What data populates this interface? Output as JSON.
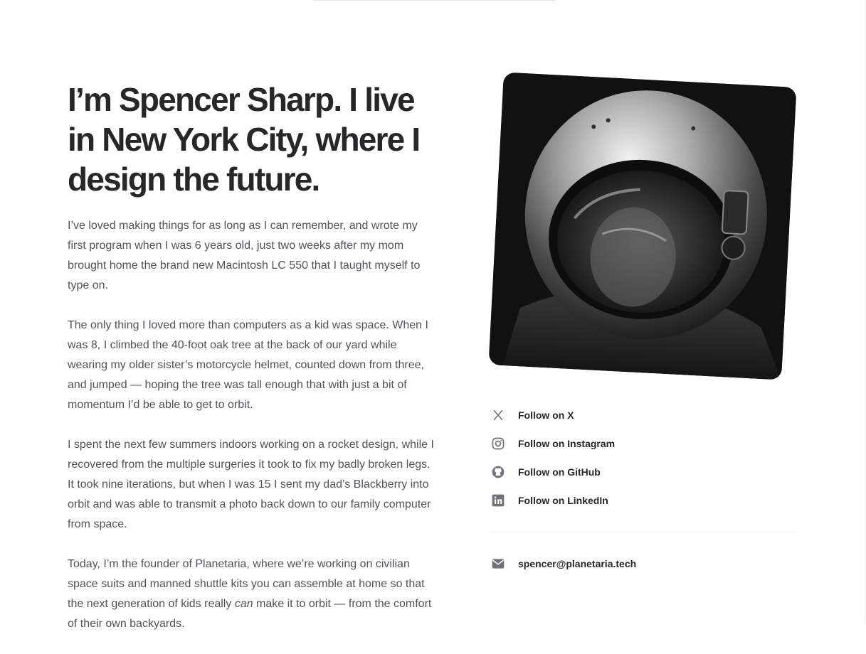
{
  "hero": {
    "headline": "I’m Spencer Sharp. I live in New York City, where I design the future."
  },
  "bio": {
    "p1": "I’ve loved making things for as long as I can remember, and wrote my first program when I was 6 years old, just two weeks after my mom brought home the brand new Macintosh LC 550 that I taught myself to type on.",
    "p2": "The only thing I loved more than computers as a kid was space. When I was 8, I climbed the 40-foot oak tree at the back of our yard while wearing my older sister’s motorcycle helmet, counted down from three, and jumped — hoping the tree was tall enough that with just a bit of momentum I’d be able to get to orbit.",
    "p3": "I spent the next few summers indoors working on a rocket design, while I recovered from the multiple surgeries it took to fix my badly broken legs. It took nine iterations, but when I was 15 I sent my dad’s Blackberry into orbit and was able to transmit a photo back down to our family computer from space.",
    "p4_before": "Today, I’m the founder of Planetaria, where we’re working on civilian space suits and manned shuttle kits you can assemble at home so that the next generation of kids really ",
    "p4_em": "can",
    "p4_after": " make it to orbit — from the comfort of their own backyards."
  },
  "social": {
    "x": "Follow on X",
    "instagram": "Follow on Instagram",
    "github": "Follow on GitHub",
    "linkedin": "Follow on LinkedIn"
  },
  "contact": {
    "email": "spencer@planetaria.tech"
  },
  "icons": {
    "x": "x-icon",
    "instagram": "instagram-icon",
    "github": "github-icon",
    "linkedin": "linkedin-icon",
    "mail": "mail-icon"
  },
  "colors": {
    "text": "#27272a",
    "body_text": "#52525b",
    "icon": "#71717a"
  }
}
